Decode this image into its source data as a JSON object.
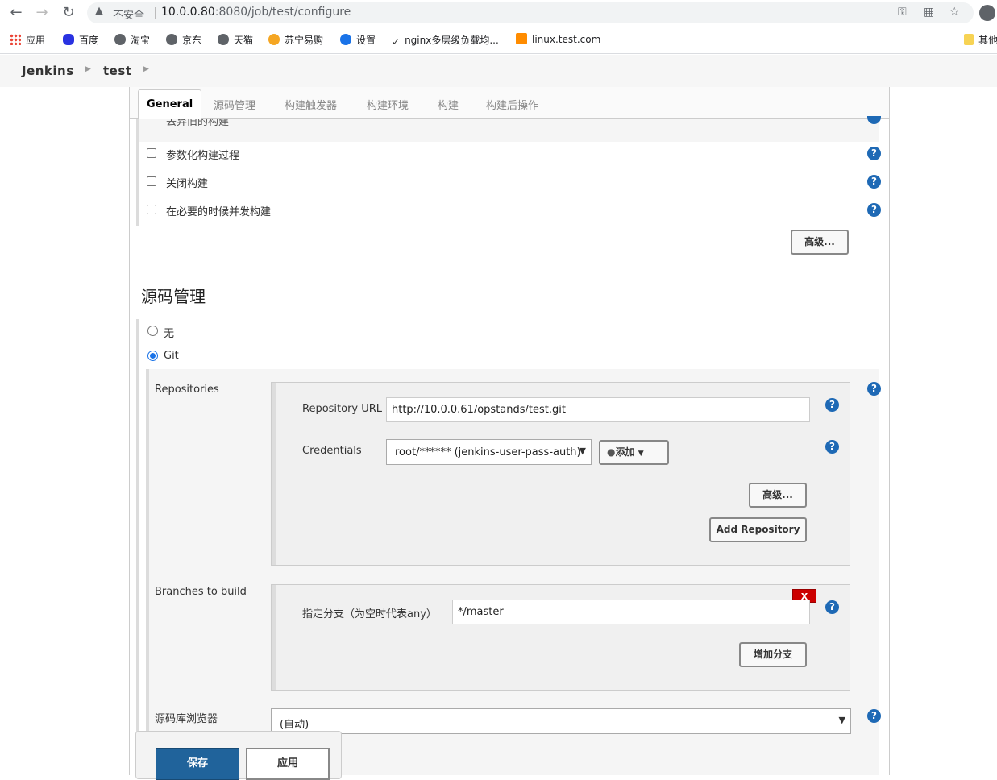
{
  "browser": {
    "security_label": "不安全",
    "url_host": "10.0.0.80",
    "url_rest": ":8080/job/test/configure",
    "bookmarks": [
      {
        "label": "应用"
      },
      {
        "label": "百度"
      },
      {
        "label": "淘宝"
      },
      {
        "label": "京东"
      },
      {
        "label": "天猫"
      },
      {
        "label": "苏宁易购"
      },
      {
        "label": "设置"
      },
      {
        "label": "nginx多层级负载均..."
      },
      {
        "label": "linux.test.com"
      },
      {
        "label": "其他"
      }
    ]
  },
  "breadcrumb": {
    "root": "Jenkins",
    "job": "test"
  },
  "tabs": [
    "General",
    "源码管理",
    "构建触发器",
    "构建环境",
    "构建",
    "构建后操作"
  ],
  "general": {
    "partial_option": "丢弃旧的构建",
    "options": [
      "参数化构建过程",
      "关闭构建",
      "在必要的时候并发构建"
    ],
    "advanced_label": "高级..."
  },
  "scm": {
    "title": "源码管理",
    "option_none": "无",
    "option_git": "Git",
    "repositories_label": "Repositories",
    "repo_url_label": "Repository URL",
    "repo_url_value": "http://10.0.0.61/opstands/test.git",
    "credentials_label": "Credentials",
    "credentials_value": "root/****** (jenkins-user-pass-auth)",
    "add_label": "添加",
    "repo_advanced_label": "高级...",
    "add_repository_label": "Add Repository",
    "branches_label": "Branches to build",
    "branch_spec_label": "指定分支（为空时代表any）",
    "branch_spec_value": "*/master",
    "delete_label": "X",
    "add_branch_label": "增加分支",
    "repo_browser_label": "源码库浏览器",
    "repo_browser_value": "(自动)"
  },
  "footer": {
    "save_label": "保存",
    "apply_label": "应用"
  },
  "colors": {
    "help": "#1e69b5",
    "save": "#20639b",
    "delete": "#cc0000"
  }
}
